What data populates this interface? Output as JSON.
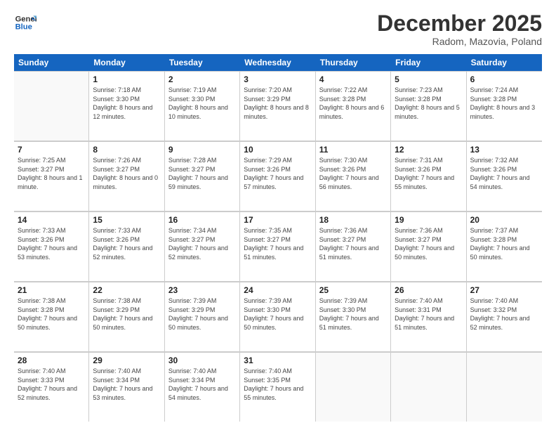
{
  "header": {
    "logo_line1": "General",
    "logo_line2": "Blue",
    "title": "December 2025",
    "subtitle": "Radom, Mazovia, Poland"
  },
  "days_of_week": [
    "Sunday",
    "Monday",
    "Tuesday",
    "Wednesday",
    "Thursday",
    "Friday",
    "Saturday"
  ],
  "weeks": [
    [
      {
        "day": "",
        "sunrise": "",
        "sunset": "",
        "daylight": "",
        "empty": true
      },
      {
        "day": "1",
        "sunrise": "Sunrise: 7:18 AM",
        "sunset": "Sunset: 3:30 PM",
        "daylight": "Daylight: 8 hours and 12 minutes."
      },
      {
        "day": "2",
        "sunrise": "Sunrise: 7:19 AM",
        "sunset": "Sunset: 3:30 PM",
        "daylight": "Daylight: 8 hours and 10 minutes."
      },
      {
        "day": "3",
        "sunrise": "Sunrise: 7:20 AM",
        "sunset": "Sunset: 3:29 PM",
        "daylight": "Daylight: 8 hours and 8 minutes."
      },
      {
        "day": "4",
        "sunrise": "Sunrise: 7:22 AM",
        "sunset": "Sunset: 3:28 PM",
        "daylight": "Daylight: 8 hours and 6 minutes."
      },
      {
        "day": "5",
        "sunrise": "Sunrise: 7:23 AM",
        "sunset": "Sunset: 3:28 PM",
        "daylight": "Daylight: 8 hours and 5 minutes."
      },
      {
        "day": "6",
        "sunrise": "Sunrise: 7:24 AM",
        "sunset": "Sunset: 3:28 PM",
        "daylight": "Daylight: 8 hours and 3 minutes."
      }
    ],
    [
      {
        "day": "7",
        "sunrise": "Sunrise: 7:25 AM",
        "sunset": "Sunset: 3:27 PM",
        "daylight": "Daylight: 8 hours and 1 minute."
      },
      {
        "day": "8",
        "sunrise": "Sunrise: 7:26 AM",
        "sunset": "Sunset: 3:27 PM",
        "daylight": "Daylight: 8 hours and 0 minutes."
      },
      {
        "day": "9",
        "sunrise": "Sunrise: 7:28 AM",
        "sunset": "Sunset: 3:27 PM",
        "daylight": "Daylight: 7 hours and 59 minutes."
      },
      {
        "day": "10",
        "sunrise": "Sunrise: 7:29 AM",
        "sunset": "Sunset: 3:26 PM",
        "daylight": "Daylight: 7 hours and 57 minutes."
      },
      {
        "day": "11",
        "sunrise": "Sunrise: 7:30 AM",
        "sunset": "Sunset: 3:26 PM",
        "daylight": "Daylight: 7 hours and 56 minutes."
      },
      {
        "day": "12",
        "sunrise": "Sunrise: 7:31 AM",
        "sunset": "Sunset: 3:26 PM",
        "daylight": "Daylight: 7 hours and 55 minutes."
      },
      {
        "day": "13",
        "sunrise": "Sunrise: 7:32 AM",
        "sunset": "Sunset: 3:26 PM",
        "daylight": "Daylight: 7 hours and 54 minutes."
      }
    ],
    [
      {
        "day": "14",
        "sunrise": "Sunrise: 7:33 AM",
        "sunset": "Sunset: 3:26 PM",
        "daylight": "Daylight: 7 hours and 53 minutes."
      },
      {
        "day": "15",
        "sunrise": "Sunrise: 7:33 AM",
        "sunset": "Sunset: 3:26 PM",
        "daylight": "Daylight: 7 hours and 52 minutes."
      },
      {
        "day": "16",
        "sunrise": "Sunrise: 7:34 AM",
        "sunset": "Sunset: 3:27 PM",
        "daylight": "Daylight: 7 hours and 52 minutes."
      },
      {
        "day": "17",
        "sunrise": "Sunrise: 7:35 AM",
        "sunset": "Sunset: 3:27 PM",
        "daylight": "Daylight: 7 hours and 51 minutes."
      },
      {
        "day": "18",
        "sunrise": "Sunrise: 7:36 AM",
        "sunset": "Sunset: 3:27 PM",
        "daylight": "Daylight: 7 hours and 51 minutes."
      },
      {
        "day": "19",
        "sunrise": "Sunrise: 7:36 AM",
        "sunset": "Sunset: 3:27 PM",
        "daylight": "Daylight: 7 hours and 50 minutes."
      },
      {
        "day": "20",
        "sunrise": "Sunrise: 7:37 AM",
        "sunset": "Sunset: 3:28 PM",
        "daylight": "Daylight: 7 hours and 50 minutes."
      }
    ],
    [
      {
        "day": "21",
        "sunrise": "Sunrise: 7:38 AM",
        "sunset": "Sunset: 3:28 PM",
        "daylight": "Daylight: 7 hours and 50 minutes."
      },
      {
        "day": "22",
        "sunrise": "Sunrise: 7:38 AM",
        "sunset": "Sunset: 3:29 PM",
        "daylight": "Daylight: 7 hours and 50 minutes."
      },
      {
        "day": "23",
        "sunrise": "Sunrise: 7:39 AM",
        "sunset": "Sunset: 3:29 PM",
        "daylight": "Daylight: 7 hours and 50 minutes."
      },
      {
        "day": "24",
        "sunrise": "Sunrise: 7:39 AM",
        "sunset": "Sunset: 3:30 PM",
        "daylight": "Daylight: 7 hours and 50 minutes."
      },
      {
        "day": "25",
        "sunrise": "Sunrise: 7:39 AM",
        "sunset": "Sunset: 3:30 PM",
        "daylight": "Daylight: 7 hours and 51 minutes."
      },
      {
        "day": "26",
        "sunrise": "Sunrise: 7:40 AM",
        "sunset": "Sunset: 3:31 PM",
        "daylight": "Daylight: 7 hours and 51 minutes."
      },
      {
        "day": "27",
        "sunrise": "Sunrise: 7:40 AM",
        "sunset": "Sunset: 3:32 PM",
        "daylight": "Daylight: 7 hours and 52 minutes."
      }
    ],
    [
      {
        "day": "28",
        "sunrise": "Sunrise: 7:40 AM",
        "sunset": "Sunset: 3:33 PM",
        "daylight": "Daylight: 7 hours and 52 minutes."
      },
      {
        "day": "29",
        "sunrise": "Sunrise: 7:40 AM",
        "sunset": "Sunset: 3:34 PM",
        "daylight": "Daylight: 7 hours and 53 minutes."
      },
      {
        "day": "30",
        "sunrise": "Sunrise: 7:40 AM",
        "sunset": "Sunset: 3:34 PM",
        "daylight": "Daylight: 7 hours and 54 minutes."
      },
      {
        "day": "31",
        "sunrise": "Sunrise: 7:40 AM",
        "sunset": "Sunset: 3:35 PM",
        "daylight": "Daylight: 7 hours and 55 minutes."
      },
      {
        "day": "",
        "sunrise": "",
        "sunset": "",
        "daylight": "",
        "empty": true
      },
      {
        "day": "",
        "sunrise": "",
        "sunset": "",
        "daylight": "",
        "empty": true
      },
      {
        "day": "",
        "sunrise": "",
        "sunset": "",
        "daylight": "",
        "empty": true
      }
    ]
  ]
}
